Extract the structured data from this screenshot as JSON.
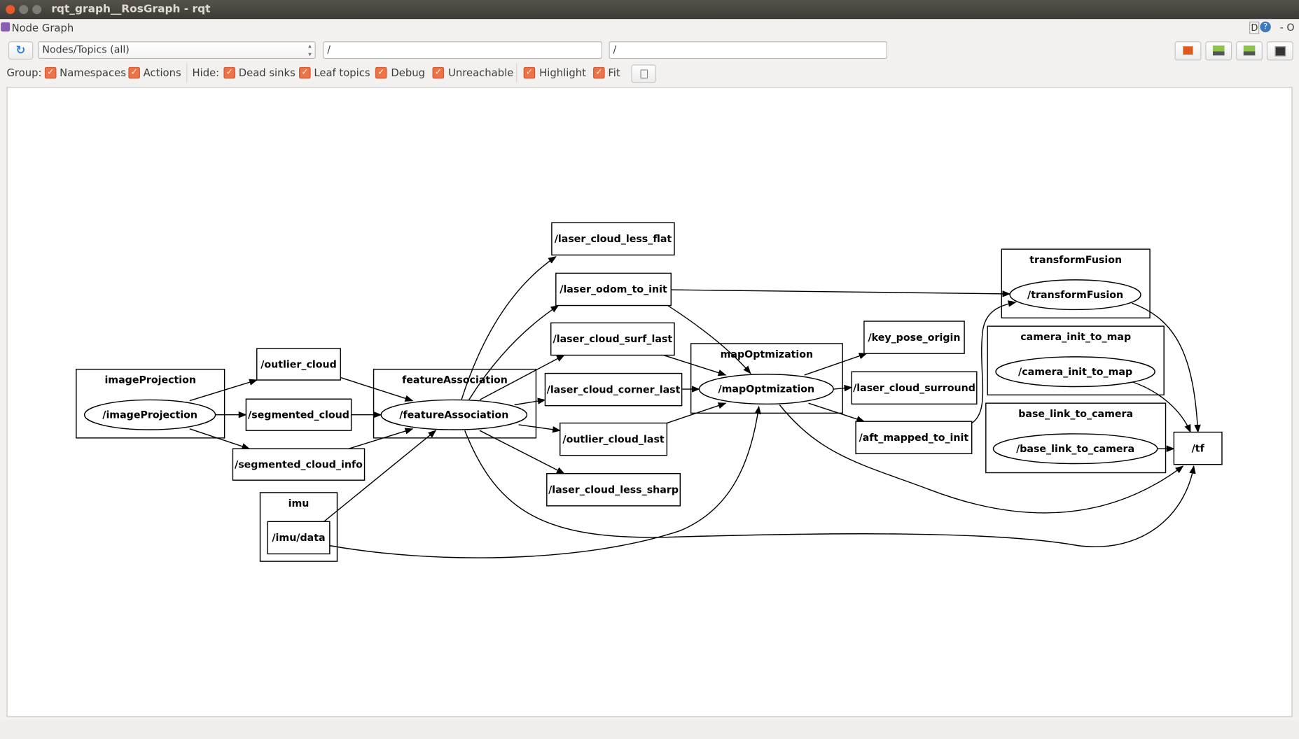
{
  "window": {
    "title": "rqt_graph__RosGraph - rqt"
  },
  "menubar": {
    "title": "Node Graph",
    "right_d": "D",
    "right_help": "?",
    "right_controls": "- O"
  },
  "toolbar": {
    "view_mode": "Nodes/Topics (all)",
    "filter_include": "/",
    "filter_exclude": "/",
    "group_label": "Group:",
    "hide_label": "Hide:",
    "checks": [
      {
        "label": "Namespaces",
        "checked": true
      },
      {
        "label": "Actions",
        "checked": true
      },
      {
        "label": "Dead sinks",
        "checked": true
      },
      {
        "label": "Leaf topics",
        "checked": true
      },
      {
        "label": "Debug",
        "checked": true
      },
      {
        "label": "Unreachable",
        "checked": true
      },
      {
        "label": "Highlight",
        "checked": true
      },
      {
        "label": "Fit",
        "checked": true
      }
    ],
    "icons": [
      "refresh-icon",
      "load-dot-icon",
      "save-dot-icon",
      "save-svg-icon",
      "screenshot-icon"
    ]
  },
  "graph": {
    "clusters": [
      {
        "id": "c_ip",
        "label": "imageProjection"
      },
      {
        "id": "c_fa",
        "label": "featureAssociation"
      },
      {
        "id": "c_mo",
        "label": "mapOptmization"
      },
      {
        "id": "c_tf",
        "label": "transformFusion"
      },
      {
        "id": "c_ci",
        "label": "camera_init_to_map"
      },
      {
        "id": "c_bl",
        "label": "base_link_to_camera"
      },
      {
        "id": "c_imu",
        "label": "imu"
      }
    ],
    "nodes": [
      {
        "id": "ip",
        "label": "/imageProjection"
      },
      {
        "id": "fa",
        "label": "/featureAssociation"
      },
      {
        "id": "mo",
        "label": "/mapOptmization"
      },
      {
        "id": "tfu",
        "label": "/transformFusion"
      },
      {
        "id": "ci",
        "label": "/camera_init_to_map"
      },
      {
        "id": "bl",
        "label": "/base_link_to_camera"
      }
    ],
    "topics": [
      {
        "id": "imu",
        "label": "/imu/data"
      },
      {
        "id": "oc",
        "label": "/outlier_cloud"
      },
      {
        "id": "sc",
        "label": "/segmented_cloud"
      },
      {
        "id": "sci",
        "label": "/segmented_cloud_info"
      },
      {
        "id": "lclf",
        "label": "/laser_cloud_less_flat"
      },
      {
        "id": "loti",
        "label": "/laser_odom_to_init"
      },
      {
        "id": "lcsl",
        "label": "/laser_cloud_surf_last"
      },
      {
        "id": "lccl",
        "label": "/laser_cloud_corner_last"
      },
      {
        "id": "ocl",
        "label": "/outlier_cloud_last"
      },
      {
        "id": "lcls",
        "label": "/laser_cloud_less_sharp"
      },
      {
        "id": "kpo",
        "label": "/key_pose_origin"
      },
      {
        "id": "lcs",
        "label": "/laser_cloud_surround"
      },
      {
        "id": "amti",
        "label": "/aft_mapped_to_init"
      },
      {
        "id": "tf",
        "label": "/tf"
      }
    ],
    "edges": [
      [
        "ip",
        "oc"
      ],
      [
        "ip",
        "sc"
      ],
      [
        "ip",
        "sci"
      ],
      [
        "oc",
        "fa"
      ],
      [
        "sc",
        "fa"
      ],
      [
        "sci",
        "fa"
      ],
      [
        "imu",
        "fa"
      ],
      [
        "fa",
        "lclf"
      ],
      [
        "fa",
        "loti"
      ],
      [
        "fa",
        "lcsl"
      ],
      [
        "fa",
        "lccl"
      ],
      [
        "fa",
        "ocl"
      ],
      [
        "fa",
        "lcls"
      ],
      [
        "fa",
        "tf"
      ],
      [
        "imu",
        "mo"
      ],
      [
        "loti",
        "tfu"
      ],
      [
        "loti",
        "mo"
      ],
      [
        "lcsl",
        "mo"
      ],
      [
        "lccl",
        "mo"
      ],
      [
        "ocl",
        "mo"
      ],
      [
        "mo",
        "kpo"
      ],
      [
        "mo",
        "lcs"
      ],
      [
        "mo",
        "amti"
      ],
      [
        "mo",
        "tf"
      ],
      [
        "amti",
        "tfu"
      ],
      [
        "tfu",
        "tf"
      ],
      [
        "ci",
        "tf"
      ],
      [
        "bl",
        "tf"
      ]
    ]
  }
}
